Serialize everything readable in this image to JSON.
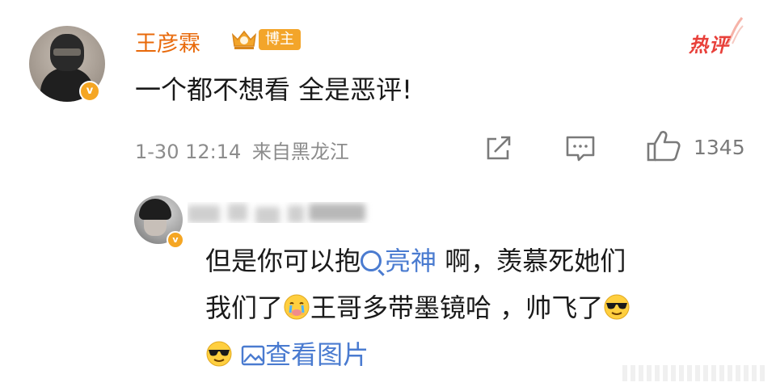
{
  "comment": {
    "username": "王彦霖",
    "badge_label": "博主",
    "hot_label": "热评",
    "text": "一个都不想看 全是恶评!",
    "timestamp": "1-30 12:14",
    "source": "来自黑龙江",
    "like_count": "1345",
    "verified_mark": "v"
  },
  "reply": {
    "line1_prefix": "但是你可以抱",
    "topic": "亮神",
    "line1_suffix": " 啊，羡慕死她们",
    "line2_prefix": "我们了",
    "line2_middle": "王哥多带墨镜哈 ，帅飞了",
    "view_image_label": "查看图片",
    "verified_mark": "v"
  },
  "colors": {
    "username": "#e8690a",
    "hot": "#e8403a",
    "link": "#4a7bd0",
    "badge": "#f3a52a",
    "verified": "#f5a623"
  },
  "icons": [
    "share-icon",
    "comment-icon",
    "like-icon",
    "search-icon",
    "image-icon",
    "crying-emoji",
    "sunglasses-emoji",
    "crown-badge-icon"
  ]
}
